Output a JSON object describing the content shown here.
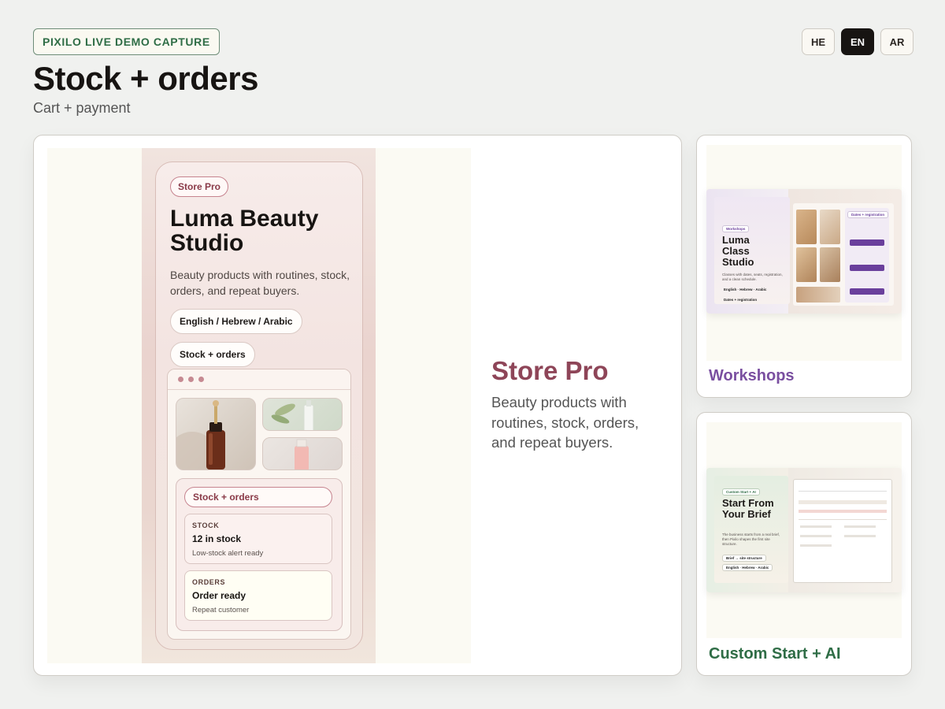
{
  "header": {
    "badge": "PIXILO LIVE DEMO CAPTURE",
    "title": "Stock + orders",
    "subtitle": "Cart + payment",
    "languages": [
      {
        "code": "HE",
        "active": false
      },
      {
        "code": "EN",
        "active": true
      },
      {
        "code": "AR",
        "active": false
      }
    ]
  },
  "main": {
    "phone": {
      "pill": "Store Pro",
      "title": "Luma Beauty Studio",
      "description": "Beauty products with routines, stock, orders, and repeat buyers.",
      "chip_languages": "English / Hebrew / Arabic",
      "chip_feature": "Stock + orders",
      "panel": {
        "pill": "Stock + orders",
        "stock": {
          "label": "STOCK",
          "value": "12 in stock",
          "note": "Low-stock alert ready"
        },
        "orders": {
          "label": "ORDERS",
          "value": "Order ready",
          "note": "Repeat customer"
        }
      }
    },
    "hero_title": "Store Pro",
    "hero_description": "Beauty products with routines, stock, orders, and repeat buyers."
  },
  "side_cards": {
    "workshops": {
      "label": "Workshops",
      "preview": {
        "pill": "Workshops",
        "title": "Luma Class Studio",
        "desc": "Classes with dates, seats, registration, and a clean schedule.",
        "lang": "English · Hebrew · Arabic",
        "feature": "Dates + registration",
        "list_title": "Dates + registration"
      }
    },
    "custom": {
      "label": "Custom Start + AI",
      "preview": {
        "pill": "Custom Start + AI",
        "title": "Start From Your Brief",
        "desc": "The business starts from a real brief, then Pixilo shapes the first site structure.",
        "chip1": "Brief → site structure",
        "chip2": "English · Hebrew · Arabic"
      }
    }
  },
  "colors": {
    "accent_store": "#8e4558",
    "accent_workshops": "#7a4fa0",
    "accent_custom": "#2f6d46"
  }
}
